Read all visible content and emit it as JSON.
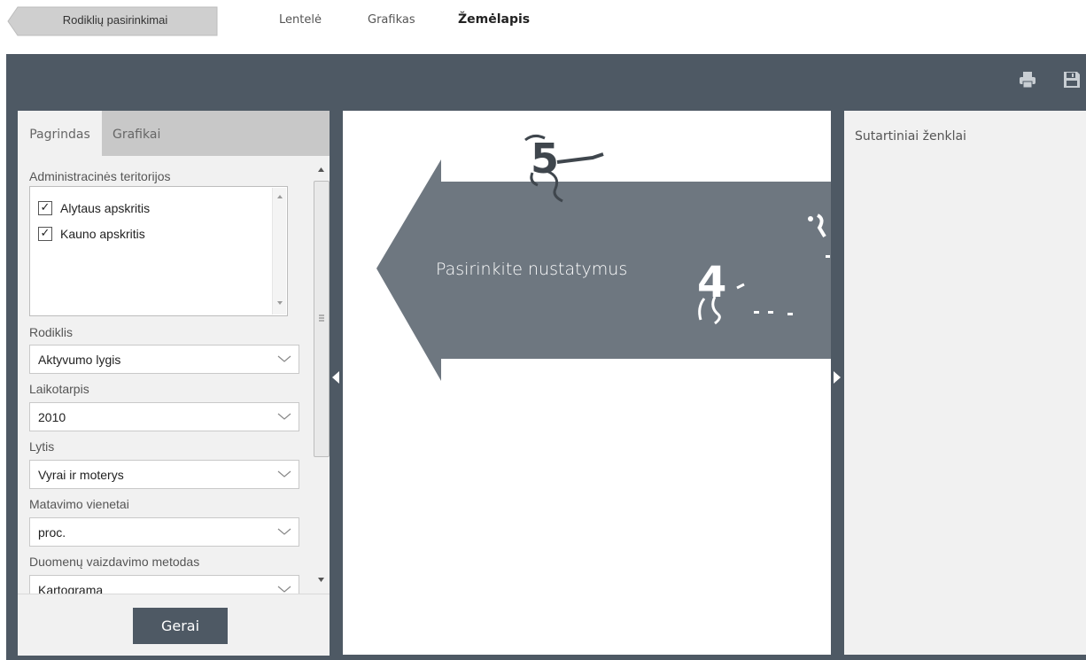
{
  "nav": {
    "back_label": "Rodiklių pasirinkimai",
    "links": [
      "Lentelė",
      "Grafikas",
      "Žemėlapis"
    ],
    "active": "Žemėlapis"
  },
  "toolbar": {
    "icons": [
      "print-icon",
      "save-icon"
    ]
  },
  "left_panel": {
    "tabs": [
      "Pagrindas",
      "Grafikai"
    ],
    "active_tab": "Pagrindas",
    "territories_label": "Administracinės teritorijos",
    "territories": [
      {
        "label": "Alytaus apskritis",
        "checked": true
      },
      {
        "label": "Kauno apskritis",
        "checked": true
      }
    ],
    "check_mark": "✓",
    "fields": [
      {
        "label": "Rodiklis",
        "value": "Aktyvumo lygis"
      },
      {
        "label": "Laikotarpis",
        "value": "2010"
      },
      {
        "label": "Lytis",
        "value": "Vyrai ir moterys"
      },
      {
        "label": "Matavimo vienetai",
        "value": "proc."
      },
      {
        "label": "Duomenų vaizdavimo metodas",
        "value": "Kartograma"
      }
    ],
    "ok_label": "Gerai"
  },
  "center": {
    "message": "Pasirinkite nustatymus"
  },
  "right_panel": {
    "title": "Sutartiniai ženklai"
  },
  "colors": {
    "frame": "#4e5964",
    "panel_bg": "#f1f1f1",
    "arrow": "#6e7780",
    "button": "#4e5964"
  }
}
